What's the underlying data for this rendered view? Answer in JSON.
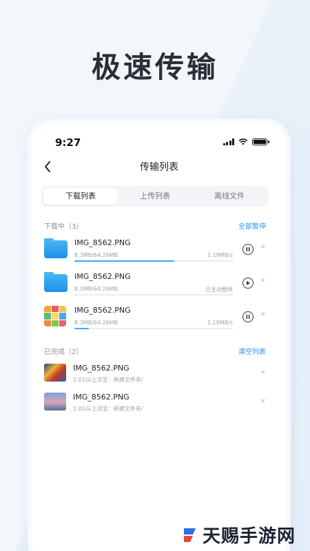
{
  "hero": {
    "title": "极速传输"
  },
  "status": {
    "time": "9:27"
  },
  "nav": {
    "title": "传输列表"
  },
  "tabs": [
    {
      "label": "下载列表",
      "active": true
    },
    {
      "label": "上传列表",
      "active": false
    },
    {
      "label": "离线文件",
      "active": false
    }
  ],
  "downloading": {
    "header": "下载中（3）",
    "action": "全部暂停",
    "items": [
      {
        "name": "IMG_8562.PNG",
        "size": "8.3MB/64.26MB",
        "status": "1.19MB/s",
        "progress": 0.63,
        "control": "pause",
        "icon": "folder-icon"
      },
      {
        "name": "IMG_8562.PNG",
        "size": "8.3MB/64.26MB",
        "status": "已主动暂停",
        "progress": 0.0,
        "control": "play",
        "icon": "folder-icon"
      },
      {
        "name": "IMG_8562.PNG",
        "size": "8.3MB/64.26MB",
        "status": "1.19MB/s",
        "progress": 0.09,
        "control": "pause",
        "icon": "image-grid-icon"
      }
    ]
  },
  "completed": {
    "header": "已完成（2）",
    "action": "清空列表",
    "items": [
      {
        "name": "IMG_8562.PNG",
        "sub": "2.01G/上次至：新建文件夹/"
      },
      {
        "name": "IMG_8562.PNG",
        "sub": "2.01G/上次至：新建文件夹/"
      }
    ]
  },
  "brand": {
    "text": "天赐手游网"
  },
  "colors": {
    "accent": "#2b8ef0",
    "progress": "#3ea6f4",
    "folder": "#1f8fe8"
  }
}
